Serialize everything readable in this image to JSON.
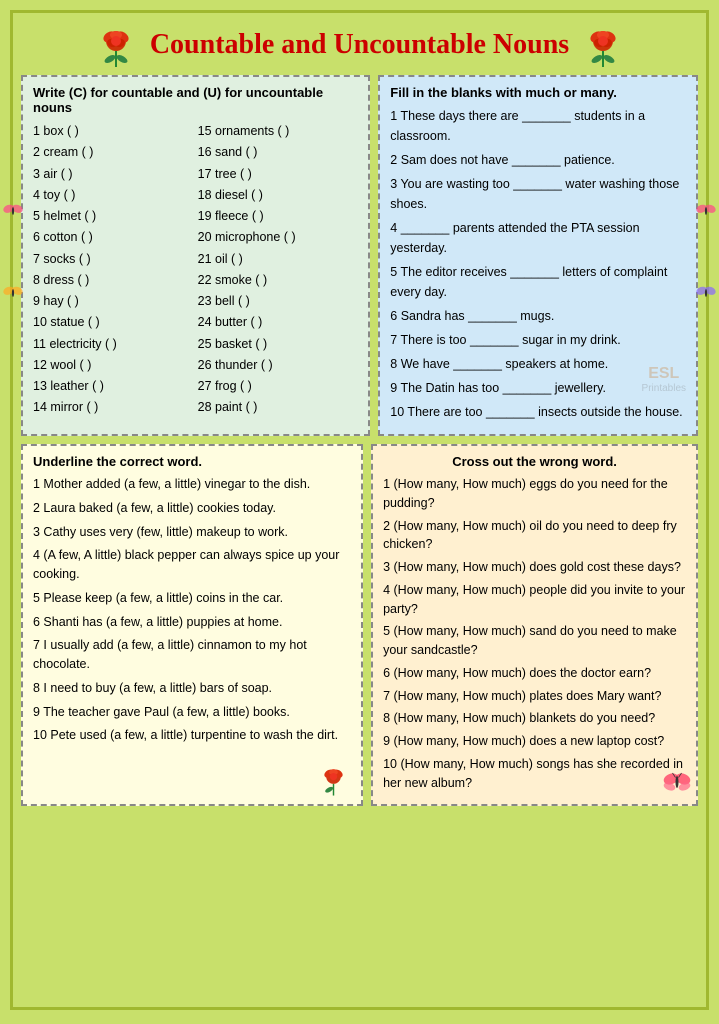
{
  "title": "Countable and Uncountable Nouns",
  "section1": {
    "instruction": "Write (C) for countable and (U) for uncountable nouns",
    "items_col1": [
      "1 box  (  )",
      "2 cream  (  )",
      "3 air  (  )",
      "4 toy  (  )",
      "5 helmet  (  )",
      "6 cotton  (  )",
      "7 socks  (  )",
      "8 dress  (  )",
      "9 hay  (  )",
      "10 statue  (  )",
      "11 electricity  (  )",
      "12 wool  (  )",
      "13 leather  (  )",
      "14 mirror  (  )"
    ],
    "items_col2": [
      "15 ornaments  (  )",
      "16 sand  (  )",
      "17 tree  (  )",
      "18 diesel  (  )",
      "19 fleece  (  )",
      "20 microphone  (  )",
      "21 oil  (  )",
      "22 smoke  (  )",
      "23 bell  (  )",
      "24 butter  (  )",
      "25 basket  (  )",
      "26 thunder  (  )",
      "27 frog  (  )",
      "28 paint  (  )"
    ]
  },
  "section2": {
    "instruction": "Fill in the blanks with much or many.",
    "sentences": [
      "1 These days there are _______ students in a classroom.",
      "2 Sam does not have _______ patience.",
      "3 You are wasting too _______ water washing those shoes.",
      "4 _______ parents attended the PTA session yesterday.",
      "5 The editor receives _______ letters of complaint every day.",
      "6 Sandra has _______ mugs.",
      "7 There is too _______ sugar in my drink.",
      "8 We have _______ speakers at home.",
      "9 The Datin has too _______ jewellery.",
      "10 There are too _______ insects outside the house."
    ]
  },
  "section3": {
    "instruction": "Underline the correct word.",
    "sentences": [
      "1 Mother added (a few, a little) vinegar to the dish.",
      "2 Laura baked (a few, a little) cookies today.",
      "3 Cathy uses very (few, little) makeup to work.",
      "4 (A few, A little) black pepper can always spice up your cooking.",
      "5 Please keep (a few, a little) coins in the car.",
      "6 Shanti has (a few, a little) puppies at home.",
      "7 I usually add (a few, a little) cinnamon to my hot chocolate.",
      "8 I need to buy (a few, a little) bars of soap.",
      "9 The teacher gave Paul (a few, a little) books.",
      "10 Pete used (a few, a little) turpentine to wash the dirt."
    ]
  },
  "section4": {
    "instruction": "Cross out the wrong word.",
    "sentences": [
      "1 (How many, How much) eggs do you need for the pudding?",
      "2 (How many, How much) oil do you need to deep fry chicken?",
      "3 (How many, How much) does gold cost these days?",
      "4 (How many, How much) people did you invite to your party?",
      "5 (How many, How much) sand do you need to make your sandcastle?",
      "6 (How many, How much) does the doctor earn?",
      "7 (How many, How much) plates does Mary want?",
      "8 (How many, How much) blankets do you need?",
      "9 (How many, How much) does a new laptop cost?",
      "10 (How many, How much) songs has she recorded in her new album?"
    ]
  }
}
